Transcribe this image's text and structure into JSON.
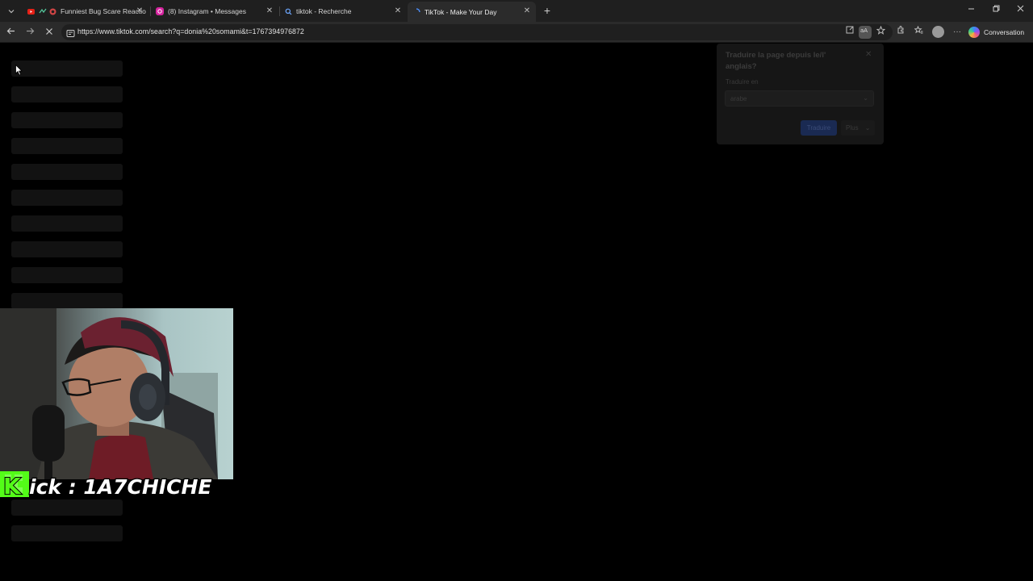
{
  "tabs": [
    {
      "title": "Funniest Bug Scare Reactio",
      "icon": "youtube-icon",
      "active": false
    },
    {
      "title": "(8) Instagram • Messages",
      "icon": "instagram-icon",
      "active": false
    },
    {
      "title": "tiktok - Recherche",
      "icon": "search-icon",
      "active": false
    },
    {
      "title": "TikTok - Make Your Day",
      "icon": "loading-icon",
      "active": true
    }
  ],
  "address_bar": {
    "url": "https://www.tiktok.com/search?q=donia%20somami&t=1767394976872"
  },
  "toolbar": {
    "copilot_label": "Conversation"
  },
  "translate_popup": {
    "title": "Traduire la page depuis le/l' anglais?",
    "translate_to_label": "Traduire en",
    "language_value": "arabe",
    "translate_button": "Traduire",
    "more_button": "Plus"
  },
  "overlay": {
    "banner_text": "Kick : 1A7CHICHE"
  },
  "colors": {
    "page_background": "#000000",
    "kick_green": "#53fc18",
    "tab_strip": "#1f1f1f",
    "toolbar": "#2b2b2b"
  }
}
